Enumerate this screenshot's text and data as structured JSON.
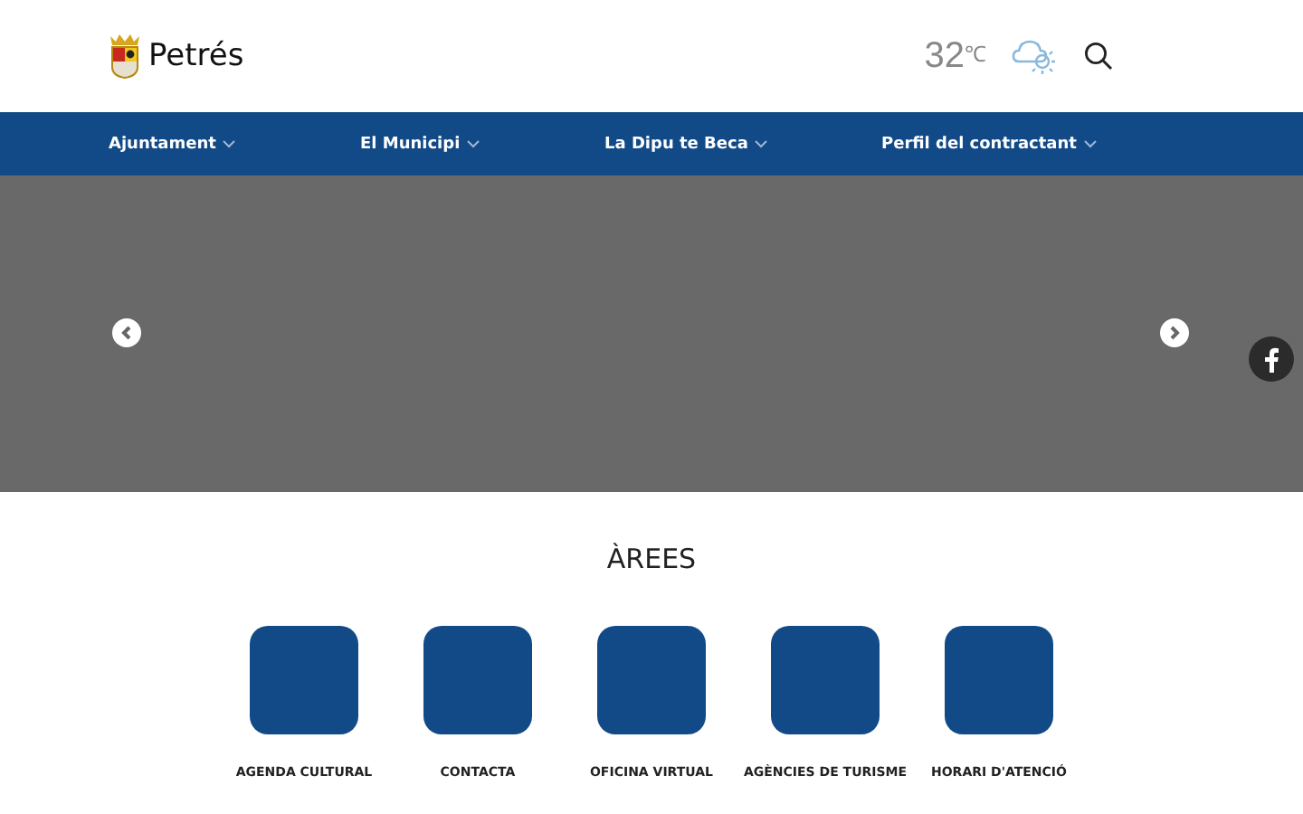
{
  "header": {
    "site_name": "Petrés",
    "temperature": "32",
    "unit": "℃"
  },
  "nav": [
    {
      "label": "Ajuntament"
    },
    {
      "label": "El Municipi"
    },
    {
      "label": "La Dipu te Beca"
    },
    {
      "label": "Perfil del contractant"
    }
  ],
  "areas": {
    "title": "ÀREES",
    "items": [
      {
        "label": "AGENDA CULTURAL"
      },
      {
        "label": "CONTACTA"
      },
      {
        "label": "OFICINA VIRTUAL"
      },
      {
        "label": "AGÈNCIES DE TURISME"
      },
      {
        "label": "HORARI D'ATENCIÓ"
      }
    ]
  }
}
